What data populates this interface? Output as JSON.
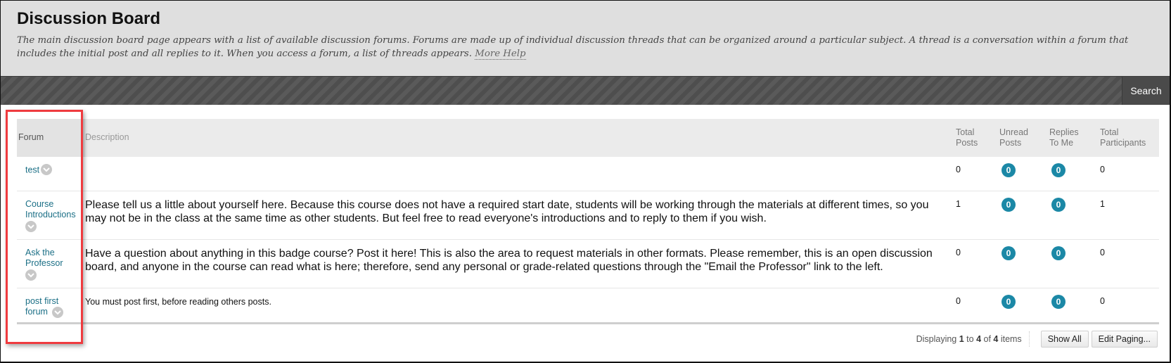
{
  "header": {
    "title": "Discussion Board",
    "help_text": "The main discussion board page appears with a list of available discussion forums. Forums are made up of individual discussion threads that can be organized around a particular subject. A thread is a conversation within a forum that includes the initial post and all replies to it. When you access a forum, a list of threads appears. ",
    "more_help_label": "More Help"
  },
  "toolbar": {
    "search_label": "Search"
  },
  "table": {
    "columns": {
      "forum": "Forum",
      "description": "Description",
      "total_posts": "Total Posts",
      "unread_posts": "Unread Posts",
      "replies_to_me": "Replies To Me",
      "total_participants": "Total Participants"
    },
    "rows": [
      {
        "forum": "test",
        "description": "",
        "total_posts": "0",
        "unread_posts": "0",
        "replies_to_me": "0",
        "total_participants": "0"
      },
      {
        "forum": "Course Introductions",
        "description": "Please tell us a little about yourself here. Because this course does not have a required start date, students will be working through the materials at different times, so you may not be in the class at the same time as other students. But feel free to read everyone's introductions and to reply to them if you wish.",
        "total_posts": "1",
        "unread_posts": "0",
        "replies_to_me": "0",
        "total_participants": "1"
      },
      {
        "forum": "Ask the Professor",
        "description": "Have a question about anything in this badge course? Post it here! This is also the area to request materials in other formats. Please remember, this is an open discussion board, and anyone in the course can read what is here; therefore, send any personal or grade-related questions through the \"Email the Professor\" link to the left.",
        "total_posts": "0",
        "unread_posts": "0",
        "replies_to_me": "0",
        "total_participants": "0"
      },
      {
        "forum": "post first forum",
        "description": "You must post first, before reading others posts.",
        "total_posts": "0",
        "unread_posts": "0",
        "replies_to_me": "0",
        "total_participants": "0"
      }
    ]
  },
  "paging": {
    "prefix": "Displaying ",
    "from": "1",
    "to_word": " to ",
    "to": "4",
    "of_word": " of ",
    "total": "4",
    "suffix": " items",
    "show_all_label": "Show All",
    "edit_paging_label": "Edit Paging..."
  },
  "colors": {
    "link": "#1b6f86",
    "badge": "#1b88a6",
    "highlight": "#ef3b3f",
    "header_bg": "#dfdfdf",
    "toolbar_bg": "#555555"
  }
}
